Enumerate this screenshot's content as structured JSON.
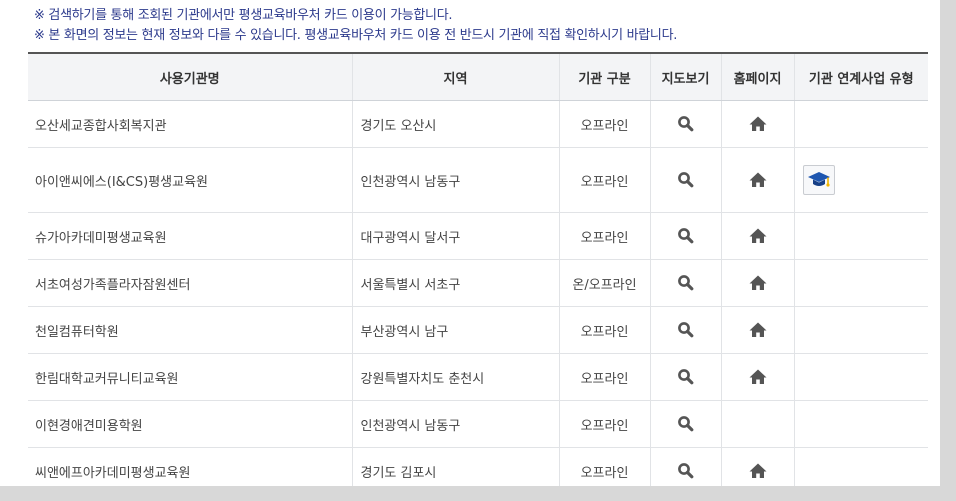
{
  "notices": [
    "※ 검색하기를 통해 조회된 기관에서만 평생교육바우처 카드 이용이 가능합니다.",
    "※ 본 화면의 정보는 현재 정보와 다를 수 있습니다. 평생교육바우처 카드 이용 전 반드시 기관에 직접 확인하시기 바랍니다."
  ],
  "table": {
    "headers": [
      "사용기관명",
      "지역",
      "기관 구분",
      "지도보기",
      "홈페이지",
      "기관 연계사업 유형"
    ],
    "rows": [
      {
        "name": "오산세교종합사회복지관",
        "region": "경기도 오산시",
        "type": "오프라인",
        "map": true,
        "home": true,
        "badge": false
      },
      {
        "name": "아이앤씨에스(I&CS)평생교육원",
        "region": "인천광역시 남동구",
        "type": "오프라인",
        "map": true,
        "home": true,
        "badge": true
      },
      {
        "name": "슈가아카데미평생교육원",
        "region": "대구광역시 달서구",
        "type": "오프라인",
        "map": true,
        "home": true,
        "badge": false
      },
      {
        "name": "서초여성가족플라자잠원센터",
        "region": "서울특별시 서초구",
        "type": "온/오프라인",
        "map": true,
        "home": true,
        "badge": false
      },
      {
        "name": "천일컴퓨터학원",
        "region": "부산광역시 남구",
        "type": "오프라인",
        "map": true,
        "home": true,
        "badge": false
      },
      {
        "name": "한림대학교커뮤니티교육원",
        "region": "강원특별자치도 춘천시",
        "type": "오프라인",
        "map": true,
        "home": true,
        "badge": false
      },
      {
        "name": "이현경애견미용학원",
        "region": "인천광역시 남동구",
        "type": "오프라인",
        "map": true,
        "home": false,
        "badge": false
      },
      {
        "name": "씨앤에프아카데미평생교육원",
        "region": "경기도 김포시",
        "type": "오프라인",
        "map": true,
        "home": true,
        "badge": false
      }
    ]
  },
  "icons": {
    "map": "search-icon",
    "home": "home-icon",
    "badge": "graduation-cap-icon"
  },
  "colors": {
    "notice_text": "#2c3a8c",
    "header_bg": "#f3f4f6",
    "icon": "#555555",
    "badge_cap": "#1e56b0",
    "badge_tassel": "#f2b500"
  }
}
